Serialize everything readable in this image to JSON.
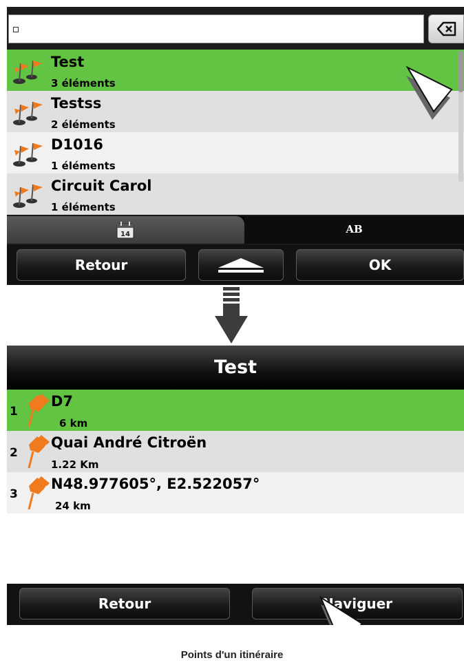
{
  "search": {
    "value": "",
    "backspace_icon": "backspace-icon"
  },
  "routes": [
    {
      "title": "Test",
      "sub": "3 éléments",
      "selected": true
    },
    {
      "title": "Testss",
      "sub": "2 éléments",
      "selected": false
    },
    {
      "title": "D1016",
      "sub": "1 éléments",
      "selected": false
    },
    {
      "title": "Circuit Carol",
      "sub": "1 éléments",
      "selected": false
    }
  ],
  "tabs": {
    "left_icon": "calendar-icon",
    "left_day": "14",
    "right_label": "AB"
  },
  "bar1": {
    "back": "Retour",
    "up_icon": "eject-up-icon",
    "ok": "OK"
  },
  "screen2": {
    "title": "Test",
    "points": [
      {
        "num": "1",
        "title": "D7",
        "sub": "6 km",
        "selected": true
      },
      {
        "num": "2",
        "title": "Quai André Citroën",
        "sub": "1.22 Km",
        "selected": false
      },
      {
        "num": "3",
        "title": "N48.977605°, E2.522057°",
        "sub": "24 km",
        "selected": false
      }
    ],
    "back": "Retour",
    "navigate": "Naviguer"
  },
  "colors": {
    "selected_row": "#63c443",
    "accent_pin": "#f07a1e"
  },
  "caption": "Points d'un itinéraire"
}
